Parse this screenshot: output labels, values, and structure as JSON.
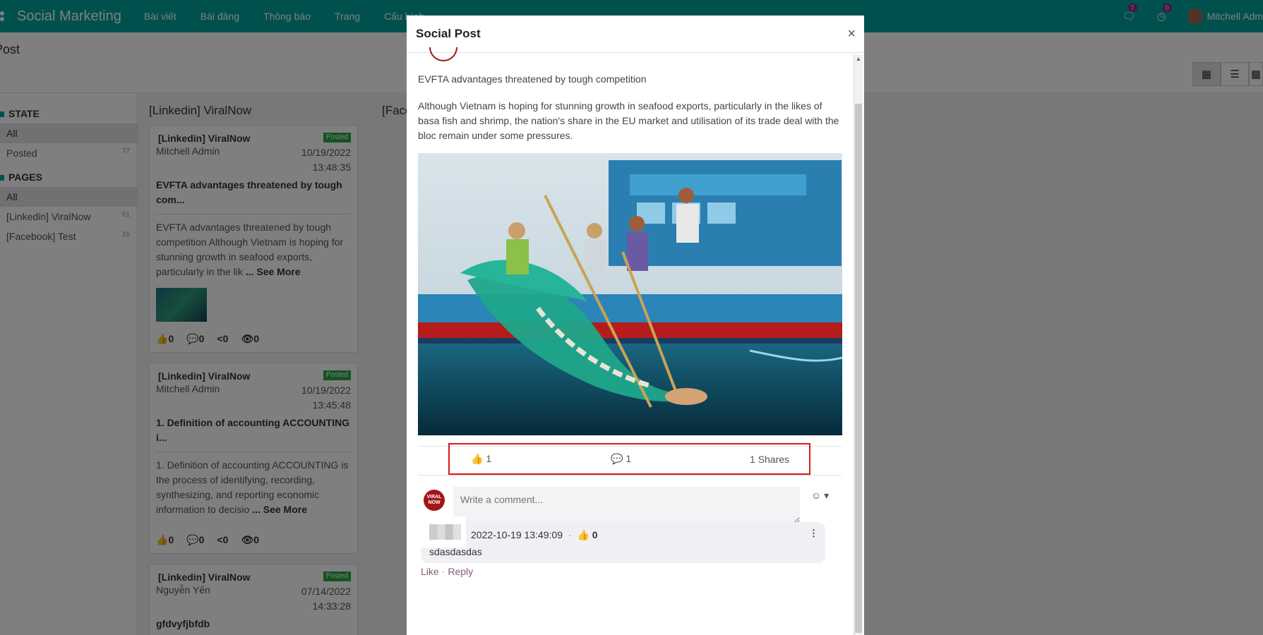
{
  "navbar": {
    "app_name": "Social Marketing",
    "menu": [
      "Bài viết",
      "Bài đăng",
      "Thông báo",
      "Trang",
      "Cấu hình"
    ],
    "messages_count": "7",
    "activities_count": "0",
    "user_name": "Mitchell Adm"
  },
  "control": {
    "breadcrumb": "Post"
  },
  "sidebar": {
    "state_title": "STATE",
    "state_items": [
      {
        "label": "All",
        "count": ""
      },
      {
        "label": "Posted",
        "count": "77"
      }
    ],
    "pages_title": "PAGES",
    "pages_items": [
      {
        "label": "All",
        "count": ""
      },
      {
        "label": "[Linkedin] ViralNow",
        "count": "61"
      },
      {
        "label": "[Facebook] Test",
        "count": "16"
      }
    ]
  },
  "kanban": {
    "col1_title": "[Linkedin] ViralNow",
    "col2_title": "[Face",
    "cards": [
      {
        "page": "[Linkedin] ViralNow",
        "status": "Posted",
        "author": "Mitchell Admin",
        "date": "10/19/2022",
        "time": "13:48:35",
        "title": "EVFTA advantages threatened by tough com...",
        "body": "EVFTA advantages threatened by tough competition Although Vietnam is hoping for stunning growth in seafood exports, particularly in the lik",
        "see_more": "... See More",
        "likes": "0",
        "comments": "0",
        "shares": "0",
        "views": "0"
      },
      {
        "page": "[Linkedin] ViralNow",
        "status": "Posted",
        "author": "Mitchell Admin",
        "date": "10/19/2022",
        "time": "13:45:48",
        "title": "1. Definition of accounting ACCOUNTING i...",
        "body": "1. Definition of accounting ACCOUNTING is the process of identifying, recording, synthesizing, and reporting economic information to decisio",
        "see_more": "... See More",
        "likes": "0",
        "comments": "0",
        "shares": "0",
        "views": "0"
      },
      {
        "page": "[Linkedin] ViralNow",
        "status": "Posted",
        "author": "Nguyễn Yến",
        "date": "07/14/2022",
        "time": "14:33:28",
        "title": "gfdvyfjbfdb"
      }
    ]
  },
  "modal": {
    "title": "Social Post",
    "post_title": "EVFTA advantages threatened by tough competition",
    "post_text": "Although Vietnam is hoping for stunning growth in seafood exports, particularly in the likes of basa fish and shrimp, the nation's share in the EU market and utilisation of its trade deal with the bloc remain under some pressures.",
    "likes": "1",
    "comments": "1",
    "shares_count": "1",
    "shares_label": "Shares",
    "comment_placeholder": "Write a comment...",
    "avatar_text": "VIRAL NOW",
    "reply": {
      "timestamp": "2022-10-19 13:49:09",
      "likes": "0",
      "text": "sdasdasdas",
      "like_label": "Like",
      "reply_label": "Reply"
    }
  }
}
